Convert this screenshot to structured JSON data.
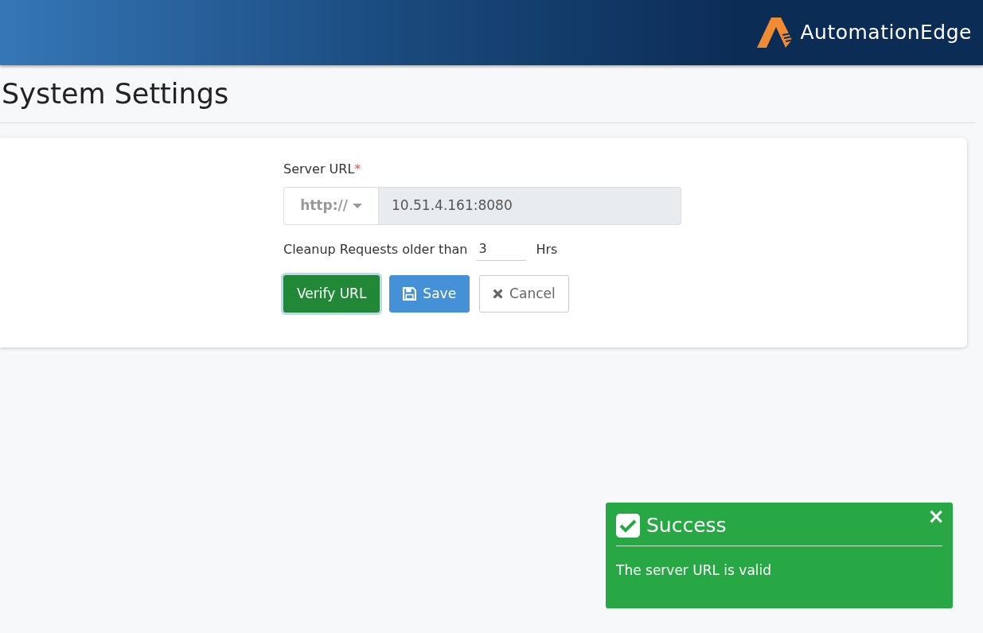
{
  "header": {
    "logo_text": "AutomationEdge"
  },
  "page_title": "System Settings",
  "server_url": {
    "label": "Server URL",
    "required_mark": "*",
    "protocol": "http://",
    "value": "10.51.4.161:8080"
  },
  "cleanup": {
    "label": "Cleanup Requests older than",
    "value": "3",
    "unit": "Hrs"
  },
  "buttons": [
    {
      "kind": "verify",
      "label": "Verify URL",
      "focused": true
    },
    {
      "kind": "save",
      "label": "Save",
      "focused": false
    },
    {
      "kind": "cancel",
      "label": "Cancel",
      "focused": false
    }
  ],
  "toast": {
    "title": "Success",
    "message": "The server URL is valid",
    "close": "×"
  }
}
